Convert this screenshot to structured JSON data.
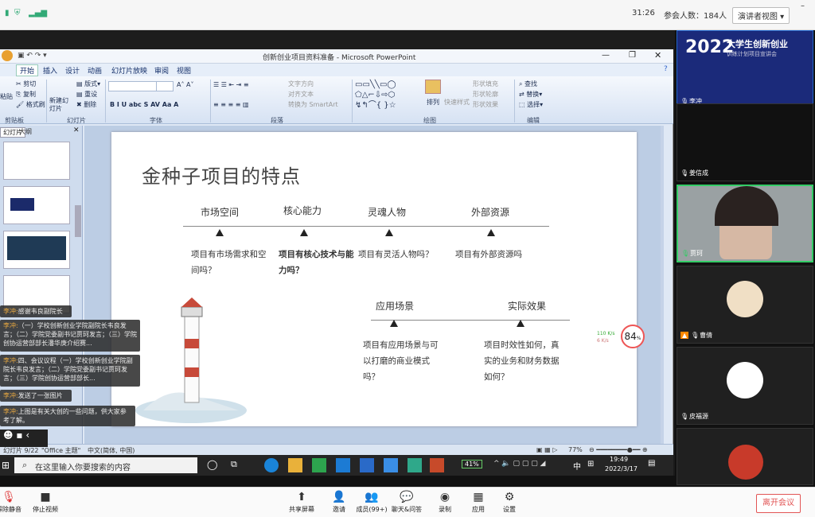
{
  "meeting": {
    "timer": "31:26",
    "participants": "参会人数：184人",
    "view_mode": "演讲者视图",
    "leave": "离开会议"
  },
  "ppt": {
    "window_title": "创新创业项目资料准备 - Microsoft PowerPoint",
    "menus": [
      "开始",
      "插入",
      "设计",
      "动画",
      "幻灯片放映",
      "审阅",
      "视图"
    ],
    "ribbon": {
      "clipboard": [
        "剪切",
        "复制",
        "格式刷"
      ],
      "paste": "粘贴",
      "new_slide": "新建幻灯片",
      "slide_ops": [
        "版式",
        "重设",
        "删除"
      ],
      "font_btns": "B  I  U  abc  S  AV  Aa  A",
      "para": [
        "文字方向",
        "对齐文本",
        "转换为 SmartArt"
      ],
      "arrange": "排列",
      "quick_styles": "快速样式",
      "shape_opts": [
        "形状填充",
        "形状轮廓",
        "形状效果"
      ],
      "edit_opts": [
        "查找",
        "替换",
        "选择"
      ],
      "groups": [
        "剪贴板",
        "幻灯片",
        "字体",
        "段落",
        "绘图",
        "编辑"
      ]
    },
    "pane_tabs": [
      "幻灯片",
      "大纲"
    ],
    "status": {
      "slide": "幻灯片 9/22",
      "theme": "\"Office 主题\"",
      "lang": "中文(简体, 中国)",
      "zoom": "77%"
    }
  },
  "slide": {
    "title": "金种子项目的特点",
    "row1": [
      {
        "head": "市场空间",
        "text": "项目有市场需求和空间吗？"
      },
      {
        "head": "核心能力",
        "text": "项目有核心技术与能力吗？"
      },
      {
        "head": "灵魂人物",
        "text": "项目有灵活人物吗？"
      },
      {
        "head": "外部资源",
        "text": "项目有外部资源吗"
      }
    ],
    "row2": [
      {
        "head": "应用场景",
        "text": "项目有应用场景与可以打磨的商业模式吗？"
      },
      {
        "head": "实际效果",
        "text": "项目时效性如何，真实的业务和财务数据如何？"
      }
    ]
  },
  "net": {
    "up": "110 K/s",
    "down": "6 K/s",
    "cpu": "84"
  },
  "chat": [
    {
      "who": "李冲:",
      "msg": "感谢韦良副院长"
    },
    {
      "who": "李冲:",
      "msg": "（一）学校创新创业学院副院长韦良发言；（二）学院党委副书记贾珂发言；（三）学院创协运营部部长潘华庚介绍赛..."
    },
    {
      "who": "李冲:",
      "msg": "四、会议议程（一）学校创新创业学院副院长韦良发言；（二）学院党委副书记贾珂发言；（三）学院创协运营部部长..."
    },
    {
      "who": "李冲:",
      "msg": "发送了一张图片"
    },
    {
      "who": "李冲:",
      "msg": "上图是有关大创的一些问题，供大家参考了解。"
    }
  ],
  "participants": [
    {
      "name": "李冲"
    },
    {
      "name": "姜信成"
    },
    {
      "name": "贾珂"
    },
    {
      "name": "曹倩"
    },
    {
      "name": "皮福源"
    }
  ],
  "banner": {
    "year": "2022",
    "line1": "大学生创新创业",
    "line2": "训练计划项目宣讲会"
  },
  "taskbar": {
    "search": "在这里输入你要搜索的内容",
    "battery": "41%",
    "ime": "中",
    "time": "19:49",
    "date": "2022/3/17"
  },
  "bottom": [
    "解除静音",
    "停止视频",
    "共享屏幕",
    "邀请",
    "成员(99+)",
    "聊天&问答",
    "录制",
    "应用",
    "设置"
  ]
}
